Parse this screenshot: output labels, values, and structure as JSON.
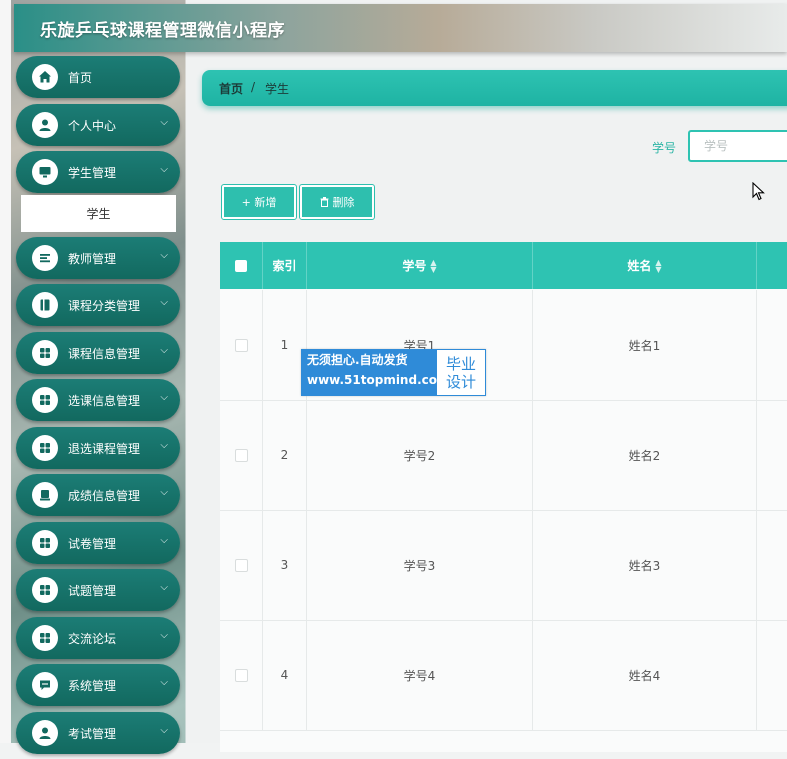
{
  "app": {
    "title": "乐旋乒乓球课程管理微信小程序"
  },
  "colors": {
    "accent": "#2ec3b2",
    "menu": "#12695f",
    "watermark": "#2f8bd8"
  },
  "breadcrumb": {
    "home": "首页",
    "separator": "/",
    "current": "学生"
  },
  "menu": {
    "items": [
      {
        "label": "首页",
        "icon": "home-icon"
      },
      {
        "label": "个人中心",
        "icon": "user-icon"
      },
      {
        "label": "学生管理",
        "icon": "monitor-icon"
      },
      {
        "label": "教师管理",
        "icon": "list-icon"
      },
      {
        "label": "课程分类管理",
        "icon": "book-icon"
      },
      {
        "label": "课程信息管理",
        "icon": "grid-icon"
      },
      {
        "label": "选课信息管理",
        "icon": "grid-icon"
      },
      {
        "label": "退选课程管理",
        "icon": "grid-icon"
      },
      {
        "label": "成绩信息管理",
        "icon": "printer-icon"
      },
      {
        "label": "试卷管理",
        "icon": "grid-icon"
      },
      {
        "label": "试题管理",
        "icon": "grid-icon"
      },
      {
        "label": "交流论坛",
        "icon": "grid-icon"
      },
      {
        "label": "系统管理",
        "icon": "chat-icon"
      },
      {
        "label": "考试管理",
        "icon": "user-icon"
      }
    ],
    "subitem": "学生"
  },
  "search": {
    "label": "学号",
    "placeholder": "学号"
  },
  "toolbar": {
    "add": "+ 新增",
    "delete": "删除"
  },
  "table": {
    "headers": {
      "index": "索引",
      "student_no": "学号",
      "name": "姓名"
    },
    "rows": [
      {
        "index": "1",
        "student_no": "学号1",
        "name": "姓名1"
      },
      {
        "index": "2",
        "student_no": "学号2",
        "name": "姓名2"
      },
      {
        "index": "3",
        "student_no": "学号3",
        "name": "姓名3"
      },
      {
        "index": "4",
        "student_no": "学号4",
        "name": "姓名4"
      }
    ]
  },
  "watermark": {
    "line1": "无须担心.自动发货",
    "line2": "www.51topmind.com",
    "side1": "毕业",
    "side2": "设计"
  }
}
